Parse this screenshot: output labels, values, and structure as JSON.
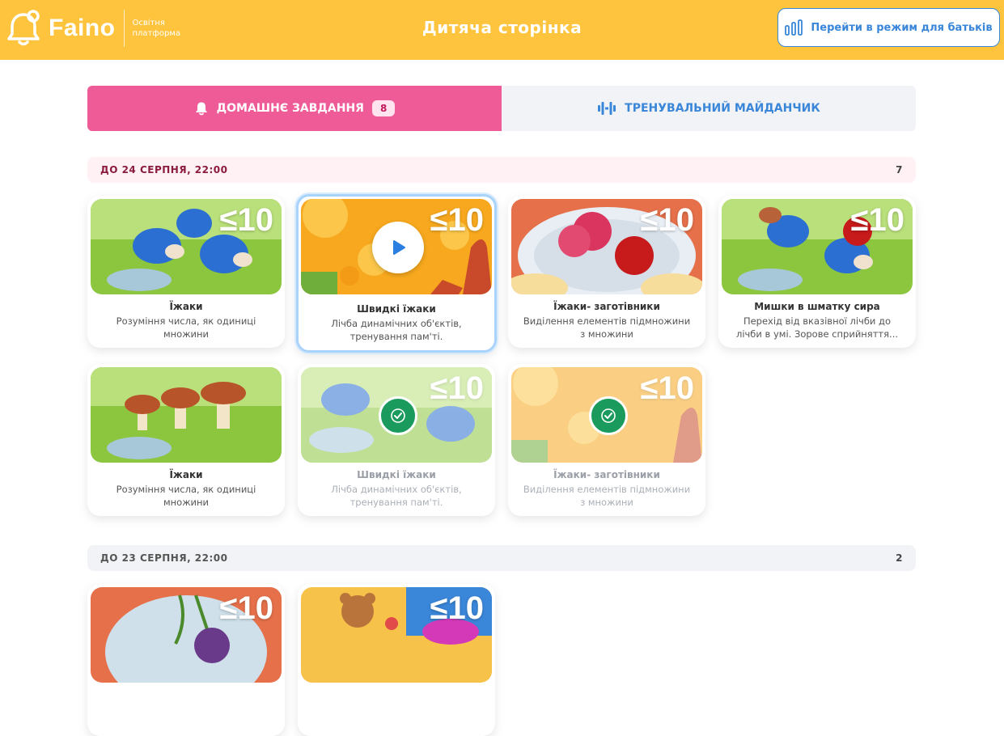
{
  "header": {
    "logo_text": "Faino",
    "logo_sub_1": "Освітня",
    "logo_sub_2": "платформа",
    "title": "Дитяча сторінка",
    "parent_button_label": "Перейти в режим для батьків"
  },
  "tabs": [
    {
      "label": "ДОМАШНЄ ЗАВДАННЯ",
      "badge": "8",
      "icon": "bell-icon",
      "active": true
    },
    {
      "label": "ТРЕНУВАЛЬНИЙ МАЙДАНЧИК",
      "icon": "dumbbell-icon",
      "active": false
    }
  ],
  "sections": [
    {
      "date": "ДО 24 СЕРПНЯ, 22:00",
      "count": "7"
    },
    {
      "date": "ДО 23 СЕРПНЯ, 22:00",
      "count": "2"
    }
  ],
  "cards": [
    {
      "limit": "≤10",
      "title": "Їжаки",
      "desc": "Розуміння числа, як одиниці множини",
      "state": "default"
    },
    {
      "limit": "≤10",
      "title": "Швидкі їжаки",
      "desc": "Лічба динамічних об'єктів, тренування пам'ті.",
      "state": "selected"
    },
    {
      "limit": "≤10",
      "title": "Їжаки- заготівники",
      "desc": "Виділення елементів підмножини з множини",
      "state": "default"
    },
    {
      "limit": "≤10",
      "title": "Мишки в шматку сира",
      "desc": "Перехід від вказівної лічби до лічби в умі. Зорове сприйняття...",
      "state": "default"
    },
    {
      "limit": "",
      "title": "Їжаки",
      "desc": "Розуміння числа, як одиниці множини",
      "state": "default"
    },
    {
      "limit": "≤10",
      "title": "Швидкі їжаки",
      "desc": "Лічба динамічних об'єктів, тренування пам'ті.",
      "state": "done"
    },
    {
      "limit": "≤10",
      "title": "Їжаки- заготівники",
      "desc": "Виділення елементів підмножини з множини",
      "state": "done"
    },
    {
      "limit": "≤10",
      "title": "",
      "desc": "",
      "state": "default"
    },
    {
      "limit": "≤10",
      "title": "",
      "desc": "",
      "state": "default"
    }
  ],
  "colors": {
    "header": "#ffc43d",
    "accent_pink": "#ef5b97",
    "accent_blue": "#3a86d9",
    "done_green": "#1a9a5c"
  }
}
